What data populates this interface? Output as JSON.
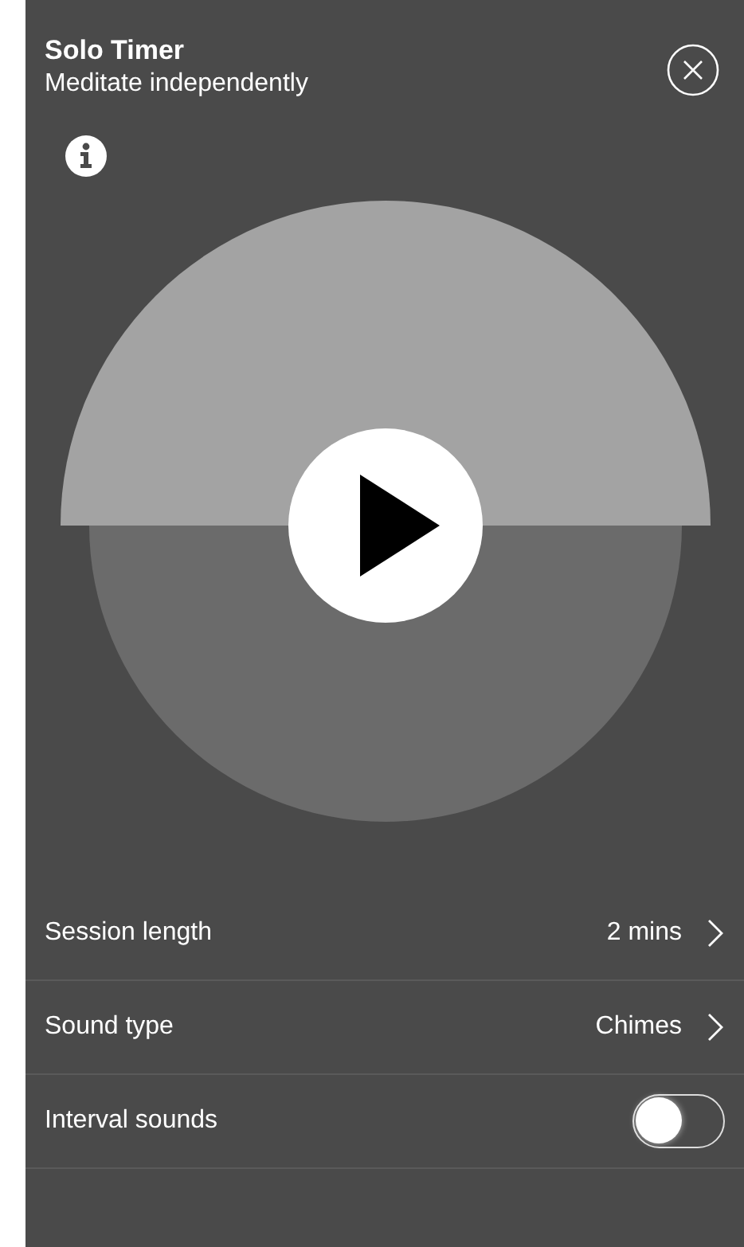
{
  "header": {
    "title": "Solo Timer",
    "subtitle": "Meditate independently"
  },
  "settings": [
    {
      "kind": "chevron",
      "label": "Session length",
      "value": "2 mins"
    },
    {
      "kind": "chevron",
      "label": "Sound type",
      "value": "Chimes"
    },
    {
      "kind": "toggle",
      "label": "Interval sounds",
      "on": false
    }
  ]
}
